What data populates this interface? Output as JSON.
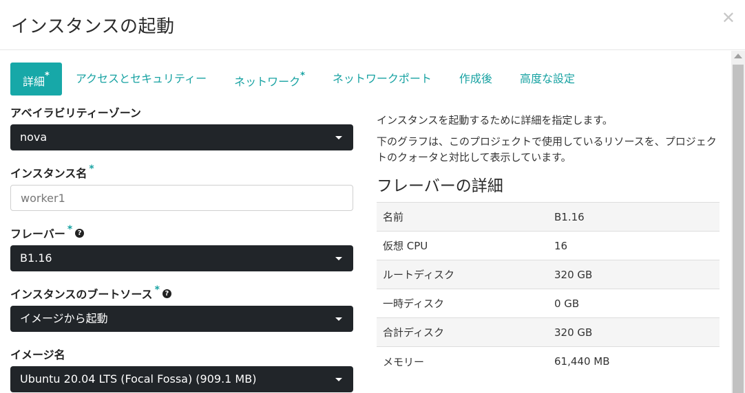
{
  "dialog": {
    "title": "インスタンスの起動",
    "close_icon": "times-icon"
  },
  "tabs": [
    {
      "label": "詳細",
      "required": "*",
      "active": true
    },
    {
      "label": "アクセスとセキュリティー",
      "required": "",
      "active": false
    },
    {
      "label": "ネットワーク",
      "required": "*",
      "active": false
    },
    {
      "label": "ネットワークポート",
      "required": "",
      "active": false
    },
    {
      "label": "作成後",
      "required": "",
      "active": false
    },
    {
      "label": "高度な設定",
      "required": "",
      "active": false
    }
  ],
  "form": {
    "availability_zone": {
      "label": "アベイラビリティーゾーン",
      "value": "nova"
    },
    "instance_name": {
      "label": "インスタンス名",
      "required": "*",
      "value": "worker1"
    },
    "flavor": {
      "label": "フレーバー",
      "required": "*",
      "help": "?",
      "value": "B1.16"
    },
    "boot_source": {
      "label": "インスタンスのブートソース",
      "required": "*",
      "help": "?",
      "value": "イメージから起動"
    },
    "image_name": {
      "label": "イメージ名",
      "value": "Ubuntu 20.04 LTS (Focal Fossa) (909.1 MB)"
    }
  },
  "info": {
    "description1": "インスタンスを起動するために詳細を指定します。",
    "description2": "下のグラフは、このプロジェクトで使用しているリソースを、プロジェクトのクォータと対比して表示しています。",
    "flavor_details_title": "フレーバーの詳細",
    "rows": [
      {
        "key": "名前",
        "value": "B1.16"
      },
      {
        "key": "仮想 CPU",
        "value": "16"
      },
      {
        "key": "ルートディスク",
        "value": "320 GB"
      },
      {
        "key": "一時ディスク",
        "value": "0 GB"
      },
      {
        "key": "合計ディスク",
        "value": "320 GB"
      },
      {
        "key": "メモリー",
        "value": "61,440 MB"
      }
    ]
  },
  "colors": {
    "accent": "#17a8a8",
    "dark_select": "#212529"
  }
}
